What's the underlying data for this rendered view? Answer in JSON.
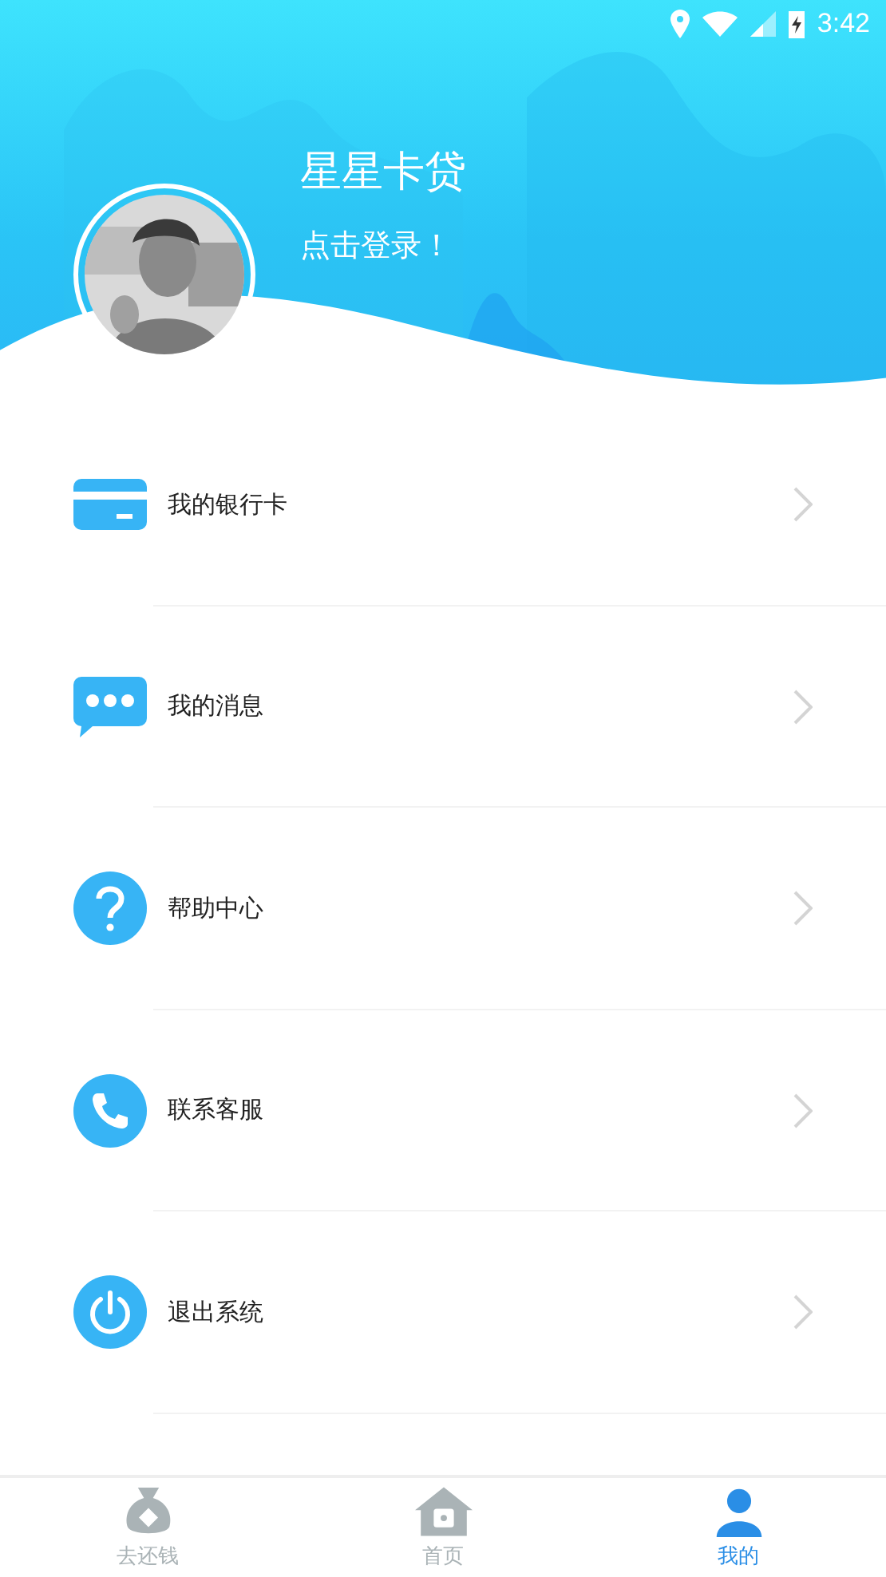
{
  "status_bar": {
    "time": "3:42"
  },
  "header": {
    "title": "星星卡贷",
    "login_prompt": "点击登录！"
  },
  "menu": [
    {
      "kind": "card",
      "label": "我的银行卡"
    },
    {
      "kind": "message",
      "label": "我的消息"
    },
    {
      "kind": "help",
      "label": "帮助中心"
    },
    {
      "kind": "phone",
      "label": "联系客服"
    },
    {
      "kind": "power",
      "label": "退出系统"
    }
  ],
  "tab_bar": [
    {
      "kind": "repay",
      "label": "去还钱",
      "selected": false
    },
    {
      "kind": "home",
      "label": "首页",
      "selected": false
    },
    {
      "kind": "me",
      "label": "我的",
      "selected": true
    }
  ]
}
